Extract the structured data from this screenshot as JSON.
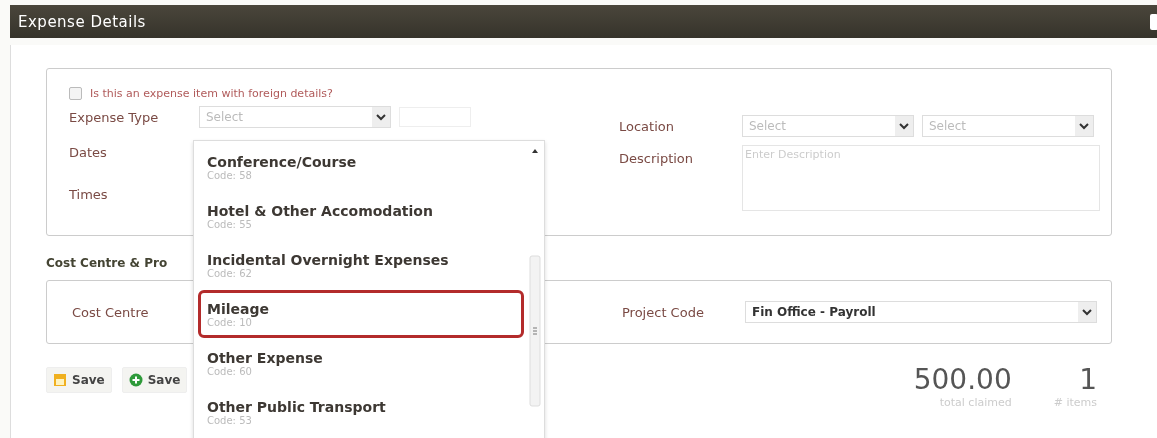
{
  "window": {
    "title": "Expense Details"
  },
  "foreign_details": {
    "label": "Is this an expense item with foreign details?",
    "checked": false
  },
  "fields": {
    "expense_type": {
      "label": "Expense Type",
      "placeholder": "Select"
    },
    "dates": {
      "label": "Dates"
    },
    "times": {
      "label": "Times"
    },
    "location": {
      "label": "Location",
      "placeholders": [
        "Select",
        "Select"
      ]
    },
    "description": {
      "label": "Description",
      "placeholder": "Enter Description"
    }
  },
  "cost_section": {
    "heading": "Cost Centre & Pro",
    "cost_centre": {
      "label": "Cost Centre"
    },
    "project_code": {
      "label": "Project Code",
      "value": "Fin Office - Payroll"
    }
  },
  "buttons": [
    {
      "label": "Save",
      "kind": "save"
    },
    {
      "label": "Save",
      "kind": "add"
    }
  ],
  "totals": [
    {
      "value": "500.00",
      "caption": "total claimed"
    },
    {
      "value": "1",
      "caption": "# items"
    }
  ],
  "dropdown": {
    "items": [
      {
        "name": "Conference/Course",
        "code": "Code: 58",
        "selected": false
      },
      {
        "name": "Hotel & Other Accomodation",
        "code": "Code: 55",
        "selected": false
      },
      {
        "name": "Incidental Overnight Expenses",
        "code": "Code: 62",
        "selected": false
      },
      {
        "name": "Mileage",
        "code": "Code: 10",
        "selected": true
      },
      {
        "name": "Other Expense",
        "code": "Code: 60",
        "selected": false
      },
      {
        "name": "Other Public Transport",
        "code": "Code: 53",
        "selected": false
      }
    ]
  }
}
